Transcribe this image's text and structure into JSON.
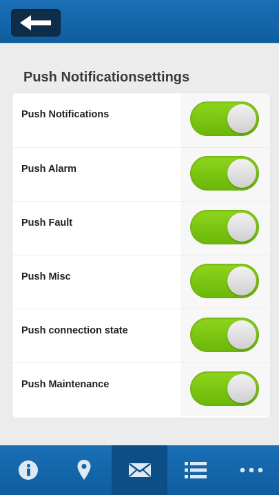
{
  "header": {
    "back_icon": "arrow-left-icon"
  },
  "page": {
    "title": "Push Notificationsettings"
  },
  "settings": [
    {
      "label": "Push Notifications",
      "enabled": true
    },
    {
      "label": "Push Alarm",
      "enabled": true
    },
    {
      "label": "Push Fault",
      "enabled": true
    },
    {
      "label": "Push Misc",
      "enabled": true
    },
    {
      "label": "Push connection state",
      "enabled": true
    },
    {
      "label": "Push Maintenance",
      "enabled": true
    }
  ],
  "bottom_nav": [
    {
      "icon": "info-icon",
      "active": false
    },
    {
      "icon": "location-pin-icon",
      "active": false
    },
    {
      "icon": "envelope-icon",
      "active": true
    },
    {
      "icon": "list-icon",
      "active": false
    },
    {
      "icon": "more-icon",
      "active": false
    }
  ],
  "colors": {
    "header_blue": "#1566ab",
    "toggle_on": "#7cc711",
    "active_tab": "#0c4f87"
  }
}
